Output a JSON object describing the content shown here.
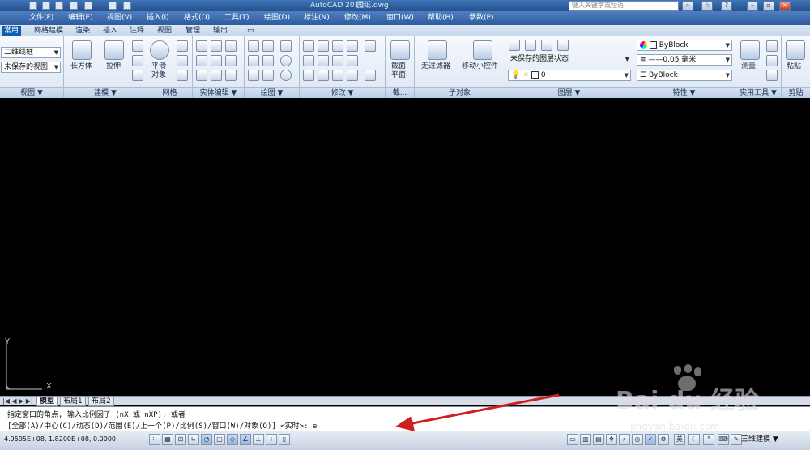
{
  "app": {
    "title": "AutoCAD 2010",
    "file": "图纸.dwg",
    "search_placeholder": "键入关键字或短语"
  },
  "menu": [
    "文件(F)",
    "编辑(E)",
    "视图(V)",
    "插入(I)",
    "格式(O)",
    "工具(T)",
    "绘图(D)",
    "标注(N)",
    "修改(M)",
    "窗口(W)",
    "帮助(H)",
    "参数(P)"
  ],
  "ribbon_tabs": [
    "常用",
    "网格建模",
    "渲染",
    "插入",
    "注释",
    "视图",
    "管理",
    "输出"
  ],
  "panels": {
    "view": {
      "title": "视图",
      "visual_style": "二维线框",
      "view_state": "未保存的视图"
    },
    "modeling": {
      "title": "建模",
      "box": "长方体",
      "extrude": "拉伸"
    },
    "mesh": {
      "title": "网格",
      "smooth": "平滑",
      "smooth2": "对象"
    },
    "solid_edit": {
      "title": "实体编辑"
    },
    "draw": {
      "title": "绘图"
    },
    "modify": {
      "title": "修改"
    },
    "section": {
      "title": "截...",
      "label1": "截面",
      "label2": "平面"
    },
    "subobject": {
      "title": "子对象",
      "filter": "无过滤器",
      "gizmo": "移动小控件"
    },
    "layers": {
      "title": "图层",
      "state": "未保存的图层状态",
      "current": "0"
    },
    "properties": {
      "title": "特性",
      "color": "ByBlock",
      "lineweight": "0.05 毫米",
      "linetype": "ByBlock"
    },
    "utilities": {
      "title": "实用工具",
      "measure": "测量"
    },
    "clipboard": {
      "title": "剪贴",
      "paste": "粘贴"
    }
  },
  "ucs": {
    "x": "X",
    "y": "Y"
  },
  "layout_tabs": [
    "模型",
    "布局1",
    "布局2"
  ],
  "command": {
    "line1": "指定窗口的角点, 输入比例因子 (nX 或 nXP), 或者",
    "line2": "[全部(A)/中心(C)/动态(D)/范围(E)/上一个(P)/比例(S)/窗口(W)/对象(O)] <实时>: e"
  },
  "status": {
    "coords": "4.9595E+08, 1.8200E+08, 0.0000",
    "workspace": "三维建模"
  },
  "watermark": {
    "text": "Bai du 经验",
    "url": "jingyan.baidu.com"
  },
  "colors": {
    "ribbon_active": "#0c5fb0",
    "arrow": "#d0201c",
    "canvas": "#000000"
  }
}
